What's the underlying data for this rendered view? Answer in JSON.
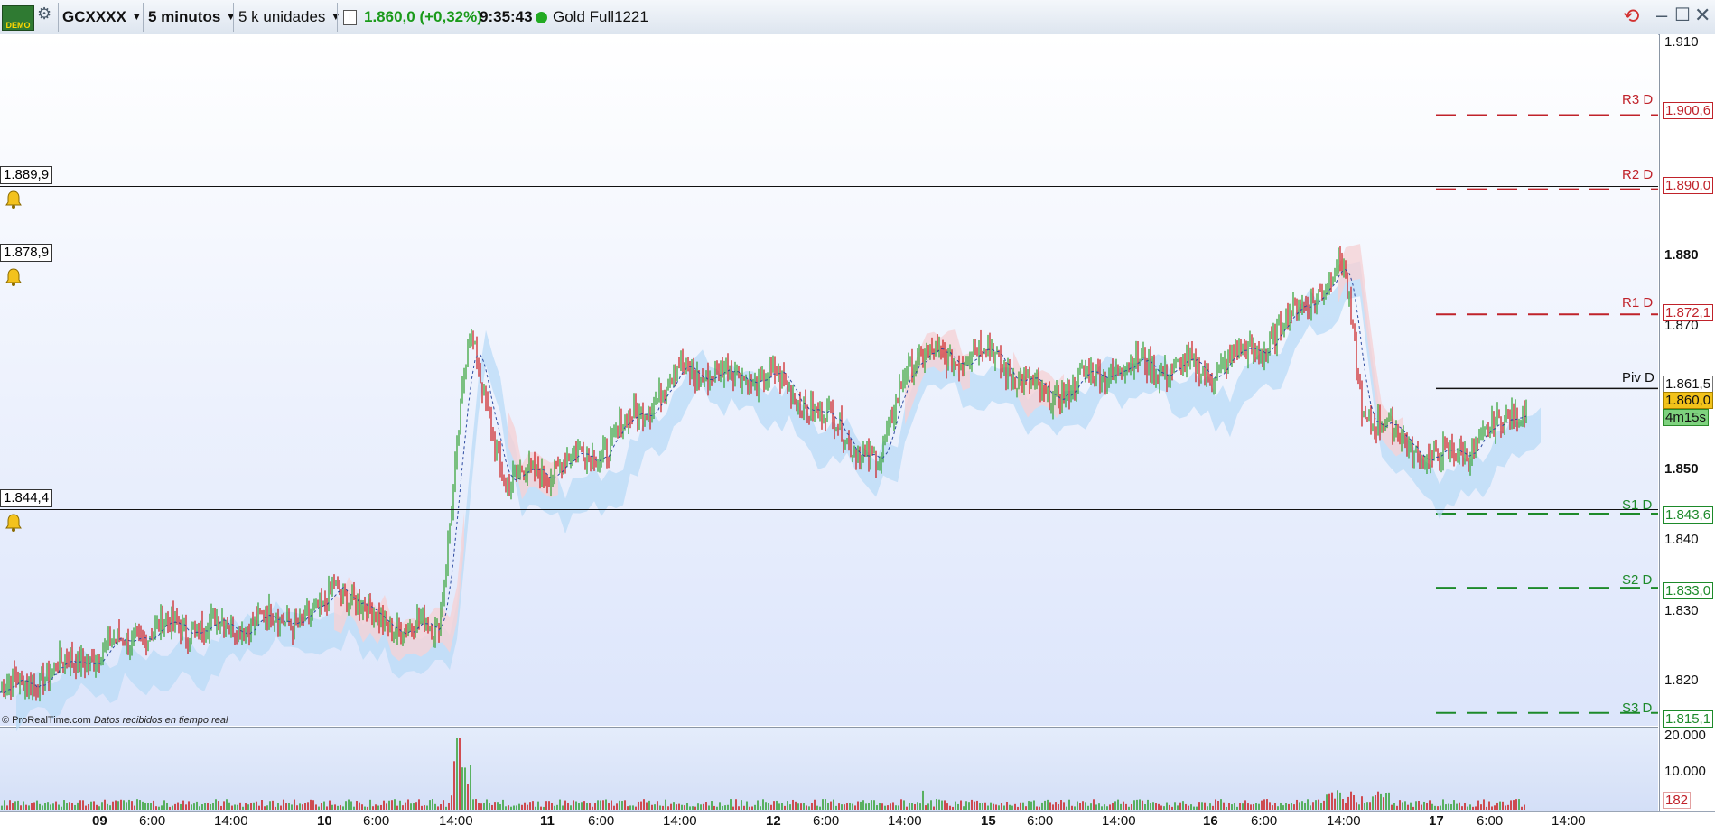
{
  "toolbar": {
    "logo_text": "DEMO",
    "symbol": "GCXXXX",
    "timeframe": "5 minutos",
    "units": "5 k unidades",
    "price": "1.860,0 (+0,32%)",
    "time": "9:35:43",
    "instrument": "Gold Full1221",
    "price_color": "#1a9a1a"
  },
  "alerts": [
    {
      "label": "1.889,9"
    },
    {
      "label": "1.878,9"
    },
    {
      "label": "1.844,4"
    }
  ],
  "y_axis": {
    "ticks": [
      "1.910",
      "1.880",
      "1.870",
      "1.850",
      "1.840",
      "1.830",
      "1.820"
    ],
    "bold_ticks": [
      "1.880",
      "1.850"
    ]
  },
  "pivots": {
    "R3": {
      "label": "R3 D",
      "value": "1.900,6"
    },
    "R2": {
      "label": "R2 D",
      "value": "1.890,0"
    },
    "R1": {
      "label": "R1 D",
      "value": "1.872,1"
    },
    "PIV": {
      "label": "Piv D",
      "value": "1.861,5"
    },
    "S1": {
      "label": "S1 D",
      "value": "1.843,6"
    },
    "S2": {
      "label": "S2 D",
      "value": "1.833,0"
    },
    "S3": {
      "label": "S3 D",
      "value": "1.815,1"
    }
  },
  "current": {
    "price": "1.860,0",
    "countdown": "4m15s"
  },
  "volume_axis": {
    "ticks": [
      "20.000",
      "10.000"
    ],
    "last": "182"
  },
  "x_axis": [
    "09",
    "6:00",
    "14:00",
    "10",
    "6:00",
    "14:00",
    "11",
    "6:00",
    "14:00",
    "12",
    "6:00",
    "14:00",
    "15",
    "6:00",
    "14:00",
    "16",
    "6:00",
    "14:00",
    "17",
    "6:00",
    "14:00"
  ],
  "footer": {
    "copyright": "© ProRealTime.com",
    "note": "Datos recibidos en tiempo real"
  },
  "colors": {
    "resistance": "#c0222a",
    "support": "#1d8a2a",
    "up": "#2ea02e",
    "down": "#cc1818",
    "cloud_up": "#b9dbf7",
    "cloud_down": "#f5d2d6"
  },
  "chart_data": {
    "type": "line",
    "title": "",
    "xlabel": "",
    "ylabel": "",
    "ylim": [
      1813,
      1911
    ],
    "x": [
      "09 00:00",
      "09 06:00",
      "09 14:00",
      "10 00:00",
      "10 06:00",
      "10 14:00",
      "10 15:00",
      "10 16:00",
      "11 00:00",
      "11 06:00",
      "11 14:00",
      "12 00:00",
      "12 06:00",
      "12 10:00",
      "12 14:00",
      "15 00:00",
      "15 06:00",
      "15 14:00",
      "16 00:00",
      "16 06:00",
      "16 12:00",
      "16 14:00",
      "16 16:00",
      "17 00:00",
      "17 06:00",
      "17 08:00"
    ],
    "series": [
      {
        "values": [
          1818,
          1827,
          1829,
          1834,
          1828,
          1827,
          1869,
          1848,
          1850,
          1853,
          1864,
          1863,
          1857,
          1850,
          1865,
          1867,
          1860,
          1865,
          1864,
          1868,
          1876,
          1879,
          1858,
          1851,
          1855,
          1860
        ]
      }
    ]
  }
}
